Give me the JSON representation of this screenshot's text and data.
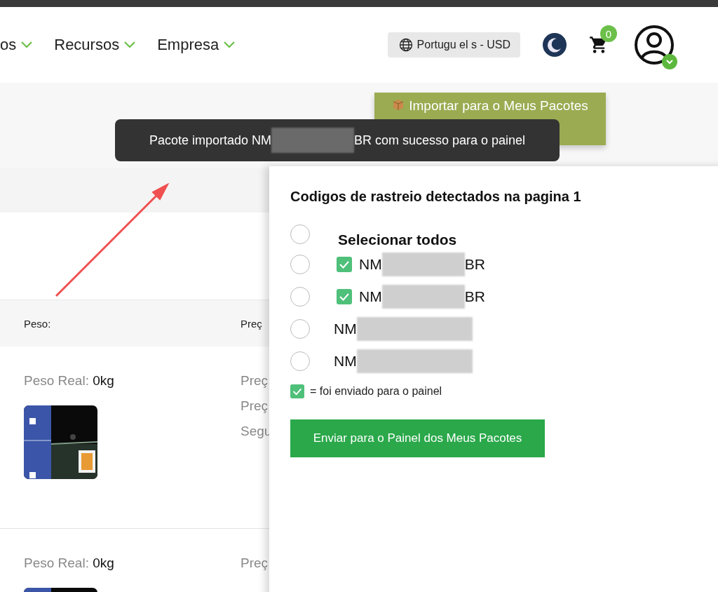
{
  "header": {
    "nav": [
      {
        "label": "os"
      },
      {
        "label": "Recursos"
      },
      {
        "label": "Empresa"
      }
    ],
    "language": "Portugu el s - USD",
    "cart_count": "0"
  },
  "import_button": "Importar para o Meus Pacotes",
  "toast": {
    "text_before": "Pacote importado NM",
    "text_after": "BR com sucesso para o painel"
  },
  "table": {
    "columns": [
      "Peso:",
      "Preç"
    ],
    "rows": [
      {
        "weight_label": "Peso Real:",
        "weight_value": "0kg",
        "price_labels": [
          "Preç",
          "Preç",
          "Segu"
        ],
        "photo": {
          "kind": "picture"
        }
      },
      {
        "weight_label": "Peso Real:",
        "weight_value": "0kg",
        "price_labels": [
          "Preç"
        ],
        "photo": {
          "kind": "picture"
        }
      }
    ]
  },
  "panel": {
    "title": "Codigos de rastreio detectados na pagina 1",
    "select_all": {
      "label": "Selecionar todos",
      "selected": false
    },
    "codes": [
      {
        "prefix": "NM",
        "suffix": "BR",
        "sent": true,
        "selected": false
      },
      {
        "prefix": "NM",
        "suffix": "BR",
        "sent": true,
        "selected": false
      },
      {
        "prefix": "NM",
        "sent": false,
        "selected": false
      },
      {
        "prefix": "NM",
        "sent": false,
        "selected": false
      }
    ],
    "legend": "= foi enviado para o painel",
    "submit": "Enviar para o Painel dos Meus Pacotes"
  }
}
